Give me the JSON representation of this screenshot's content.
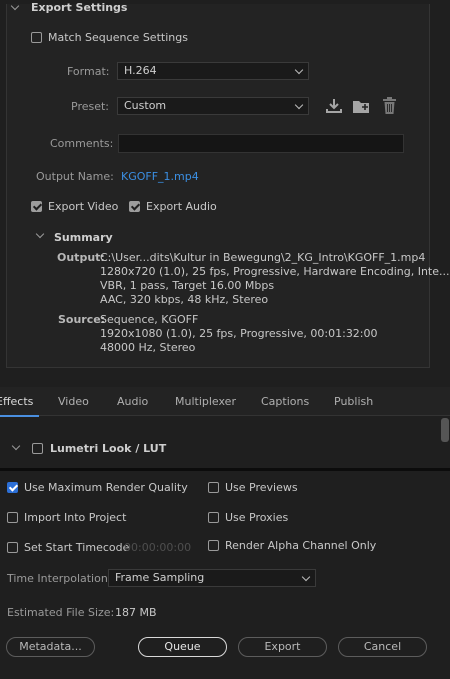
{
  "export_settings": {
    "title": "Export Settings",
    "match_sequence_label": "Match Sequence Settings",
    "format_label": "Format:",
    "format_value": "H.264",
    "preset_label": "Preset:",
    "preset_value": "Custom",
    "comments_label": "Comments:",
    "comments_value": "",
    "output_name_label": "Output Name:",
    "output_name_value": "KGOFF_1.mp4",
    "export_video_label": "Export Video",
    "export_video_checked": true,
    "export_audio_label": "Export Audio",
    "export_audio_checked": true
  },
  "summary": {
    "title": "Summary",
    "output_label": "Output:",
    "output_lines": [
      "C:\\User...dits\\Kultur in Bewegung\\2_KG_Intro\\KGOFF_1.mp4",
      "1280x720 (1.0), 25 fps, Progressive, Hardware Encoding, Inte...",
      "VBR, 1 pass, Target 16.00 Mbps",
      "AAC, 320 kbps, 48 kHz, Stereo"
    ],
    "source_label": "Source:",
    "source_lines": [
      "Sequence, KGOFF",
      "1920x1080 (1.0), 25 fps, Progressive, 00:01:32:00",
      "48000 Hz, Stereo"
    ]
  },
  "tabs": [
    "Effects",
    "Video",
    "Audio",
    "Multiplexer",
    "Captions",
    "Publish"
  ],
  "effects": {
    "lumetri_label": "Lumetri Look / LUT"
  },
  "options": {
    "max_render_quality": "Use Maximum Render Quality",
    "max_render_quality_checked": true,
    "use_previews": "Use Previews",
    "import_into_project": "Import Into Project",
    "use_proxies": "Use Proxies",
    "set_start_timecode": "Set Start Timecode",
    "start_timecode_value": "00:00:00:00",
    "render_alpha": "Render Alpha Channel Only",
    "time_interp_label": "Time Interpolation:",
    "time_interp_value": "Frame Sampling",
    "est_size_label": "Estimated File Size:",
    "est_size_value": "187 MB"
  },
  "buttons": {
    "metadata": "Metadata...",
    "queue": "Queue",
    "export": "Export",
    "cancel": "Cancel"
  },
  "colors": {
    "accent": "#3b8fe3",
    "checkbox_blue": "#2c6fd6",
    "background": "#1f1f1f"
  }
}
